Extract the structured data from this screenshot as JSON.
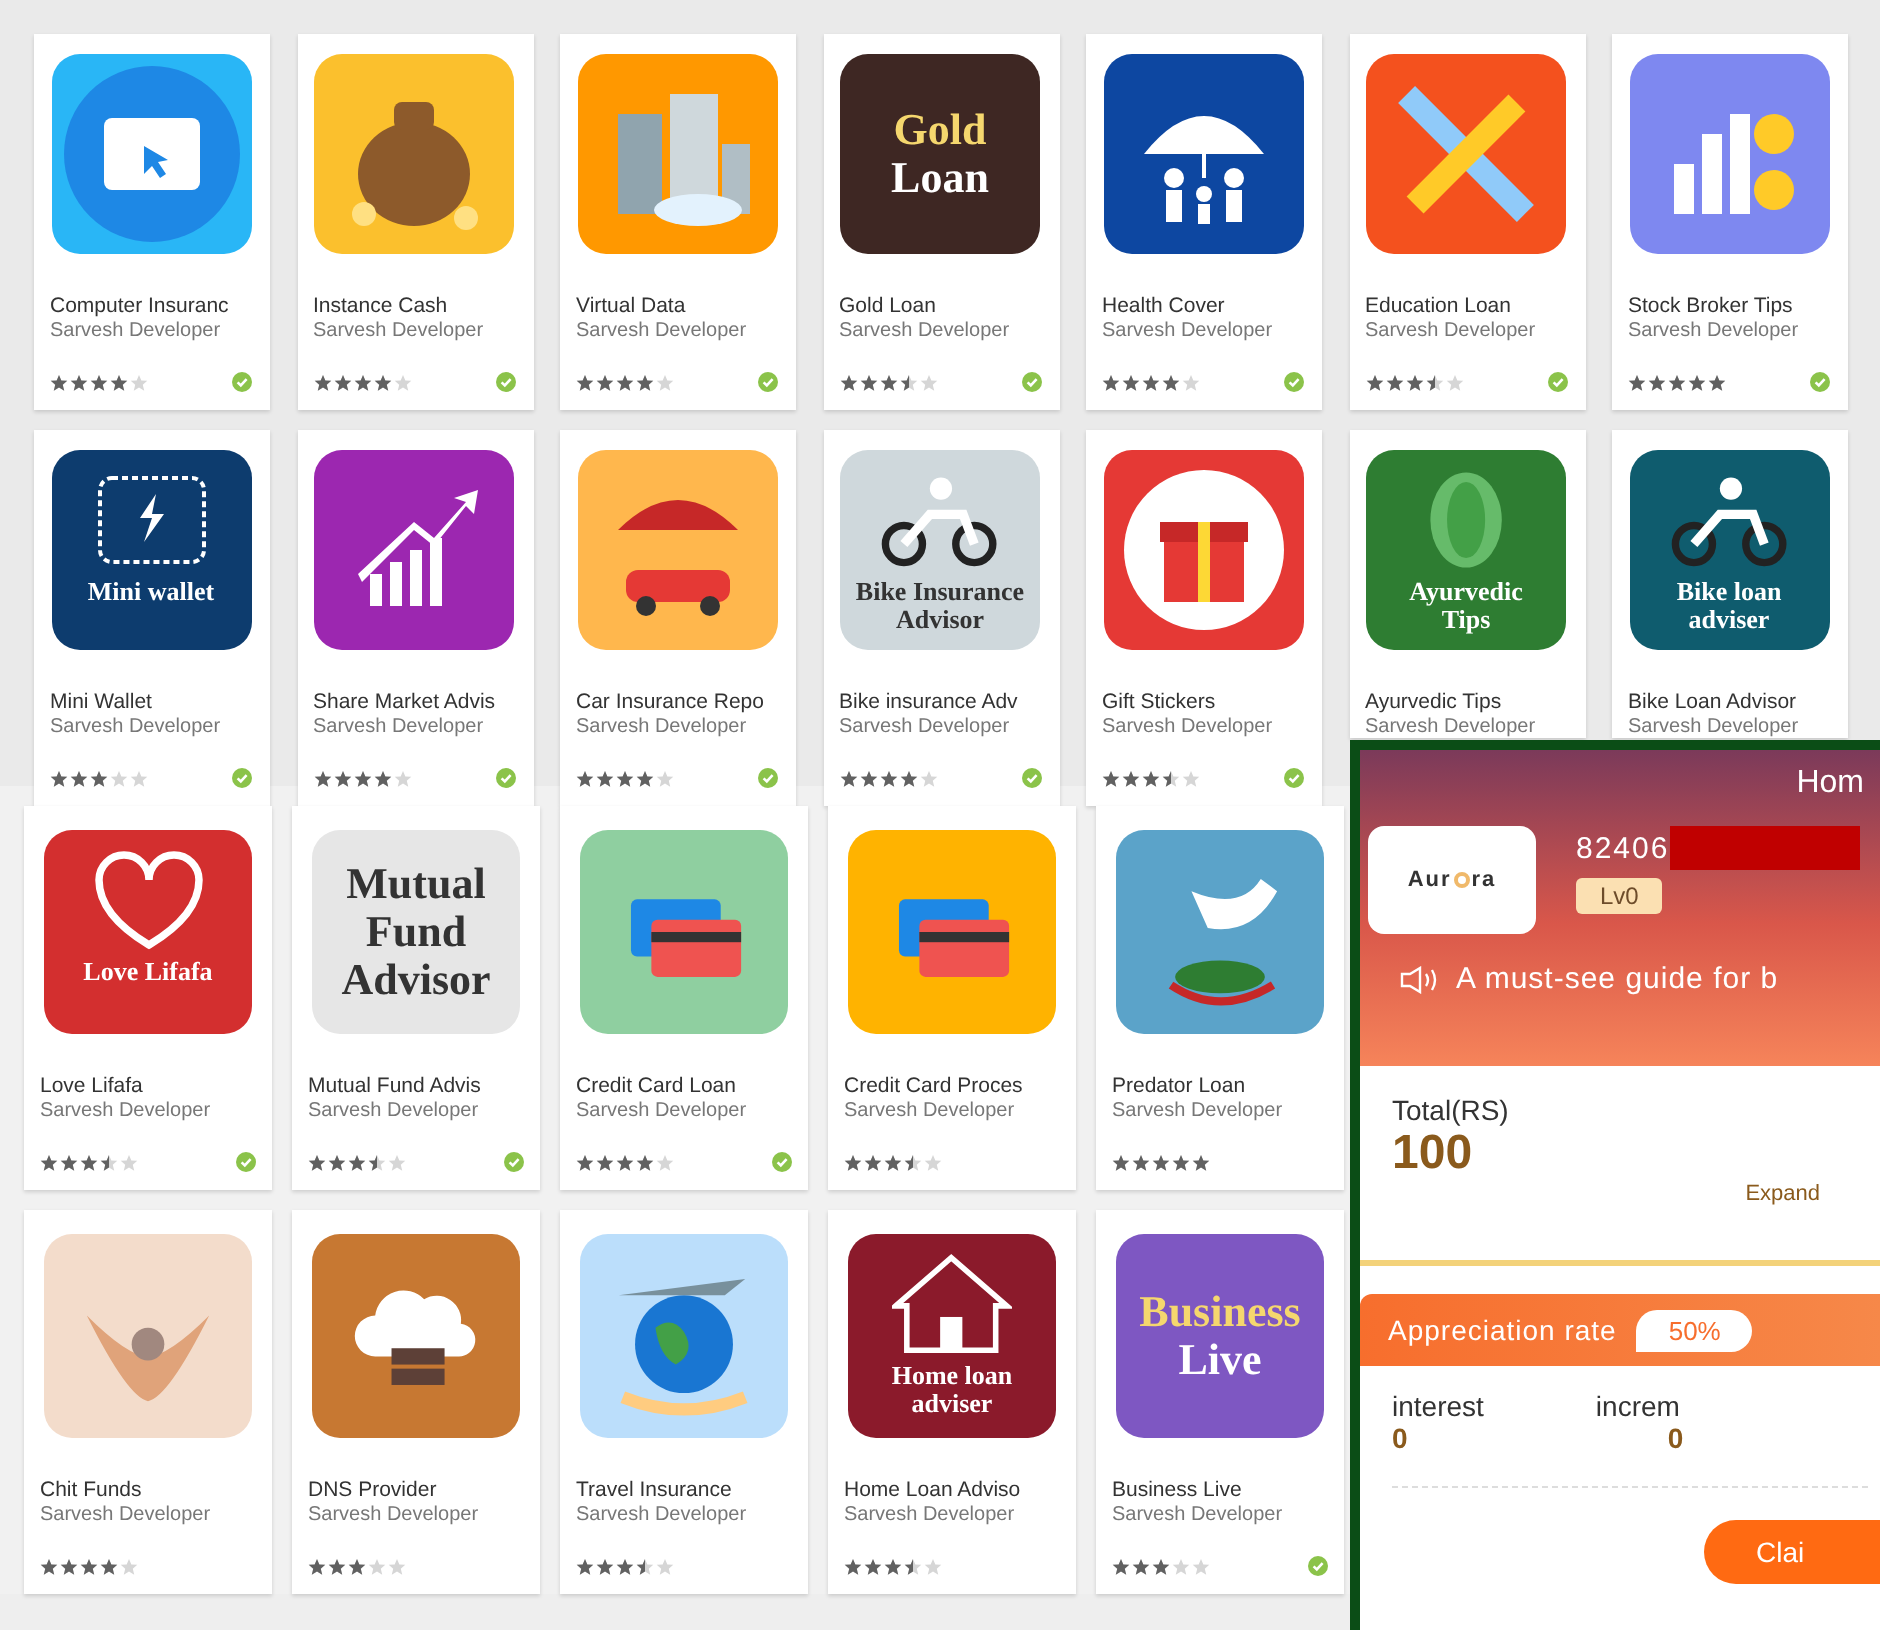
{
  "top_apps": [
    {
      "title": "Computer Insuranc",
      "developer": "Sarvesh Developer",
      "kind": "browser",
      "color": "#29b6f6",
      "stars": 4,
      "verified": true
    },
    {
      "title": "Instance Cash",
      "developer": "Sarvesh Developer",
      "kind": "moneybag",
      "color": "#fbc02d",
      "stars": 4,
      "verified": true
    },
    {
      "title": "Virtual Data",
      "developer": "Sarvesh Developer",
      "kind": "buildings",
      "color": "#ff9800",
      "stars": 4,
      "verified": true
    },
    {
      "title": "Gold Loan",
      "developer": "Sarvesh Developer",
      "kind": "text",
      "color": "#3e2723",
      "icon_text": [
        "Gold",
        "Loan"
      ],
      "stars": 3.5,
      "verified": true
    },
    {
      "title": "Health Cover",
      "developer": "Sarvesh Developer",
      "kind": "umbrella",
      "color": "#0d47a1",
      "stars": 4,
      "verified": true
    },
    {
      "title": "Education Loan",
      "developer": "Sarvesh Developer",
      "kind": "pencil",
      "color": "#f4511e",
      "stars": 3.5,
      "verified": true
    },
    {
      "title": "Stock Broker Tips",
      "developer": "Sarvesh Developer",
      "kind": "chart",
      "color": "#7e88f0",
      "stars": 5,
      "verified": true
    },
    {
      "title": "Mini Wallet",
      "developer": "Sarvesh Developer",
      "kind": "wallet",
      "color": "#0d3c6e",
      "icon_text": [
        "Mini wallet"
      ],
      "stars": 3,
      "verified": true
    },
    {
      "title": "Share Market Advis",
      "developer": "Sarvesh Developer",
      "kind": "arrow-chart",
      "color": "#9c27b0",
      "stars": 4,
      "verified": true
    },
    {
      "title": "Car Insurance Repo",
      "developer": "Sarvesh Developer",
      "kind": "car",
      "color": "#ffb74d",
      "stars": 4,
      "verified": true
    },
    {
      "title": "Bike insurance Adv",
      "developer": "Sarvesh Developer",
      "kind": "bike",
      "color": "#cfd8dc",
      "icon_text": [
        "Bike Insurance",
        "Advisor"
      ],
      "stars": 4,
      "verified": true
    },
    {
      "title": "Gift Stickers",
      "developer": "Sarvesh Developer",
      "kind": "gift",
      "color": "#e53935",
      "stars": 3.5,
      "verified": true
    },
    {
      "title": "Ayurvedic Tips",
      "developer": "Sarvesh Developer",
      "kind": "leaf",
      "color": "#2e7d32",
      "icon_text": [
        "Ayurvedic",
        "Tips"
      ]
    },
    {
      "title": "Bike Loan Advisor",
      "developer": "Sarvesh Developer",
      "kind": "bike",
      "color": "#0f5c6e",
      "icon_text": [
        "Bike loan adviser"
      ]
    }
  ],
  "bottom_apps": [
    {
      "title": "Love Lifafa",
      "developer": "Sarvesh Developer",
      "kind": "hearts",
      "color": "#d32f2f",
      "icon_text": [
        "Love Lifafa"
      ],
      "stars": 3.5,
      "verified": true
    },
    {
      "title": "Mutual Fund Advis",
      "developer": "Sarvesh Developer",
      "kind": "text",
      "color": "#e6e6e6",
      "icon_text": [
        "Mutual",
        "Fund",
        "Advisor"
      ],
      "stars": 3.5,
      "verified": true
    },
    {
      "title": "Credit Card Loan",
      "developer": "Sarvesh Developer",
      "kind": "card",
      "color": "#8fcfa0",
      "stars": 4,
      "verified": true
    },
    {
      "title": "Credit Card Proces",
      "developer": "Sarvesh Developer",
      "kind": "card",
      "color": "#ffb300",
      "stars": 3.5,
      "verified": false
    },
    {
      "title": "Predator Loan",
      "developer": "Sarvesh Developer",
      "kind": "hand",
      "color": "#5ba3c9",
      "stars": 5,
      "verified": false
    },
    {
      "title": "Chit Funds",
      "developer": "Sarvesh Developer",
      "kind": "coins",
      "color": "#f3dccb",
      "stars": 4,
      "verified": false
    },
    {
      "title": "DNS Provider",
      "developer": "Sarvesh Developer",
      "kind": "server",
      "color": "#c77832",
      "stars": 3,
      "verified": false
    },
    {
      "title": "Travel Insurance",
      "developer": "Sarvesh Developer",
      "kind": "globe",
      "color": "#bbdefb",
      "stars": 3.5,
      "verified": false
    },
    {
      "title": "Home Loan Adviso",
      "developer": "Sarvesh Developer",
      "kind": "house",
      "color": "#8b1a2b",
      "icon_text": [
        "Home loan adviser"
      ],
      "stars": 3.5,
      "verified": false
    },
    {
      "title": "Business Live",
      "developer": "Sarvesh Developer",
      "kind": "text",
      "color": "#7e57c2",
      "icon_text": [
        "Business",
        "Live"
      ],
      "stars": 3,
      "verified": true
    }
  ],
  "phone": {
    "title": "Hom",
    "logo_left": "Aur",
    "logo_right": "ra",
    "account": "82406",
    "redacted": true,
    "level": "Lv0",
    "notice": "A must-see guide for b",
    "total_label": "Total(RS)",
    "total_value": "100",
    "expand": "Expand",
    "rate_label": "Appreciation rate",
    "rate_value": "50%",
    "stats": [
      {
        "label": "interest",
        "value": "0"
      },
      {
        "label": "increm",
        "value": "0"
      }
    ],
    "claim": "Clai"
  }
}
